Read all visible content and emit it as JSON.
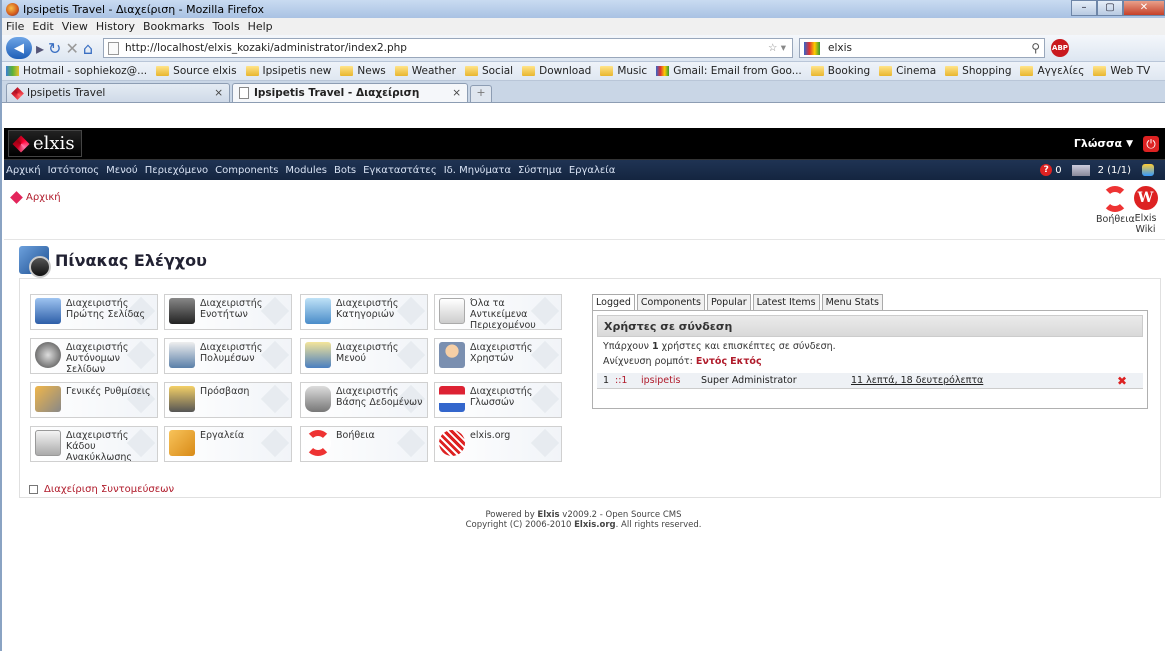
{
  "window": {
    "title": "Ipsipetis Travel - Διαχείριση - Mozilla Firefox"
  },
  "menubar": [
    "File",
    "Edit",
    "View",
    "History",
    "Bookmarks",
    "Tools",
    "Help"
  ],
  "nav": {
    "url": "http://localhost/elxis_kozaki/administrator/index2.php",
    "search_value": "elxis"
  },
  "bookmarks": [
    {
      "label": "Hotmail - sophiekoz@...",
      "icon": "hotmail-icon"
    },
    {
      "label": "Source elxis",
      "icon": "folder-icon"
    },
    {
      "label": "Ipsipetis new",
      "icon": "folder-icon"
    },
    {
      "label": "News",
      "icon": "folder-icon"
    },
    {
      "label": "Weather",
      "icon": "folder-icon"
    },
    {
      "label": "Social",
      "icon": "folder-icon"
    },
    {
      "label": "Download",
      "icon": "folder-icon"
    },
    {
      "label": "Music",
      "icon": "folder-icon"
    },
    {
      "label": "Gmail: Email from Goo...",
      "icon": "gmail-icon"
    },
    {
      "label": "Booking",
      "icon": "folder-icon"
    },
    {
      "label": "Cinema",
      "icon": "folder-icon"
    },
    {
      "label": "Shopping",
      "icon": "folder-icon"
    },
    {
      "label": "Αγγελίες",
      "icon": "folder-icon"
    },
    {
      "label": "Web TV",
      "icon": "folder-icon"
    }
  ],
  "tabs": [
    {
      "label": "Ipsipetis Travel",
      "close": "×"
    },
    {
      "label": "Ipsipetis Travel - Διαχείριση",
      "close": "×"
    }
  ],
  "newtab": "+",
  "elxis": {
    "logo": "elxis",
    "lang": "Γλώσσα",
    "menu": [
      "Αρχική",
      "Ιστότοπος",
      "Μενού",
      "Περιεχόμενο",
      "Components",
      "Modules",
      "Bots",
      "Εγκαταστάτες",
      "Ιδ. Μηνύματα",
      "Σύστημα",
      "Εργαλεία"
    ],
    "msg_count": "0",
    "users_online": "2 (1/1)"
  },
  "breadcrumb": "Αρχική",
  "help_buttons": [
    {
      "label": "Βοήθεια"
    },
    {
      "label": "Elxis Wiki"
    }
  ],
  "cpanel_title": "Πίνακας Ελέγχου",
  "tiles": [
    [
      "Διαχειριστής Πρώτης Σελίδας",
      "Διαχειριστής Ενοτήτων",
      "Διαχειριστής Κατηγοριών",
      "Όλα τα Αντικείμενα Περιεχομένου"
    ],
    [
      "Διαχειριστής Αυτόνομων Σελίδων",
      "Διαχειριστής Πολυμέσων",
      "Διαχειριστής Μενού",
      "Διαχειριστής Χρηστών"
    ],
    [
      "Γενικές Ρυθμίσεις",
      "Πρόσβαση",
      "Διαχειριστής Βάσης Δεδομένων",
      "Διαχειριστής Γλωσσών"
    ],
    [
      "Διαχειριστής Κάδου Ανακύκλωσης",
      "Εργαλεία",
      "Βοήθεια",
      "elxis.org"
    ]
  ],
  "shortcut_link": "Διαχείριση Συντομεύσεων",
  "stats": {
    "tabs": [
      "Logged",
      "Components",
      "Popular",
      "Latest Items",
      "Menu Stats"
    ],
    "header": "Χρήστες σε σύνδεση",
    "line1_pre": "Υπάρχουν ",
    "line1_count": "1",
    "line1_post": " χρήστες και επισκέπτες σε σύνδεση.",
    "robots_label": "Ανίχνευση ρομπότ:",
    "robots_on": "Εντός",
    "robots_off": "Εκτός",
    "row": {
      "num": "1",
      "ip": "::1",
      "user": "ipsipetis",
      "group": "Super Administrator",
      "time": "11 λεπτά, 18 δευτερόλεπτα"
    }
  },
  "footer": {
    "line1_pre": "Powered by ",
    "line1_brand": "Elxis",
    "line1_post": " v2009.2 - Open Source CMS",
    "line2_pre": "Copyright (C) 2006-2010 ",
    "line2_brand": "Elxis.org",
    "line2_post": ". All rights reserved."
  }
}
